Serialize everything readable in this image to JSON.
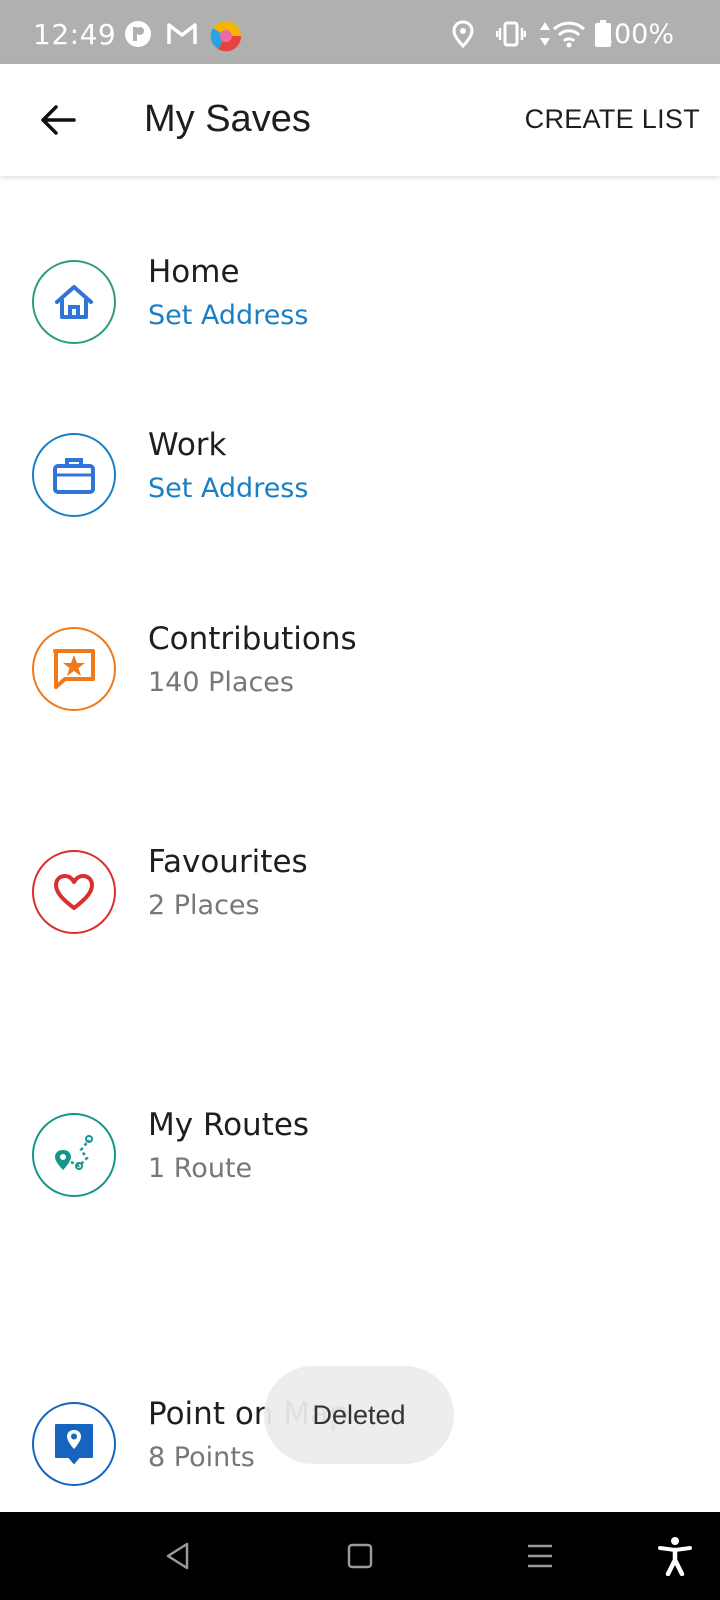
{
  "status_bar": {
    "time": "12:49",
    "battery": "100%",
    "icons": [
      "app-icon",
      "gmail-icon",
      "chrome-icon",
      "location-icon",
      "vibrate-icon",
      "data-arrows-icon",
      "wifi-icon",
      "battery-icon"
    ]
  },
  "header": {
    "title": "My Saves",
    "action": "CREATE LIST",
    "back_icon": "back-arrow-icon"
  },
  "items": [
    {
      "title": "Home",
      "subtitle": "Set Address",
      "icon": "home-icon",
      "color": "#2e9d7e"
    },
    {
      "title": "Work",
      "subtitle": "Set Address",
      "icon": "briefcase-icon",
      "color": "#1a7fc4"
    },
    {
      "title": "Contributions",
      "subtitle": "140 Places",
      "icon": "star-message-icon",
      "color": "#f07a1a"
    },
    {
      "title": "Favourites",
      "subtitle": "2 Places",
      "icon": "heart-icon",
      "color": "#d92f2f"
    },
    {
      "title": "My Routes",
      "subtitle": "1 Route",
      "icon": "route-icon",
      "color": "#16968a"
    },
    {
      "title": "Point on Map",
      "subtitle": "8 Points",
      "icon": "map-pin-icon",
      "color": "#1565c0"
    }
  ],
  "toast": {
    "text": "Deleted"
  },
  "nav_bar": {
    "icons": [
      "back-triangle-icon",
      "home-square-icon",
      "recents-menu-icon",
      "accessibility-icon"
    ]
  },
  "colors": {
    "link": "#1a7fc4",
    "status_bar": "#b0b0b0",
    "nav_bar": "#000000"
  }
}
